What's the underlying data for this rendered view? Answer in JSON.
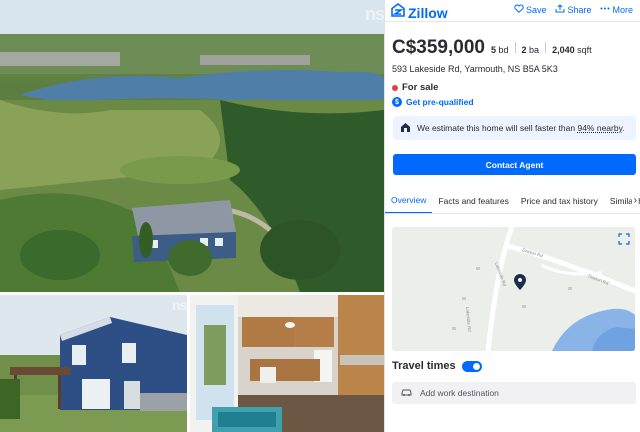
{
  "header": {
    "logo_text": "Zillow",
    "actions": [
      {
        "label": "Save",
        "icon": "heart-icon"
      },
      {
        "label": "Share",
        "icon": "share-icon"
      },
      {
        "label": "More",
        "icon": "more-icon"
      }
    ]
  },
  "gallery": {
    "watermark": "ns"
  },
  "listing": {
    "price": "C$359,000",
    "beds_value": "5",
    "beds_unit": "bd",
    "baths_value": "2",
    "baths_unit": "ba",
    "sqft_value": "2,040",
    "sqft_unit": "sqft",
    "address": "593 Lakeside Rd, Yarmouth, NS B5A 5K3",
    "status": "For sale",
    "status_color": "#e5403c",
    "prequal_label": "Get pre-qualified"
  },
  "estimate": {
    "text_before": "We estimate this home will sell faster than ",
    "percent": "94% nearby",
    "text_after": "."
  },
  "contact_button": "Contact Agent",
  "tabs": [
    {
      "label": "Overview"
    },
    {
      "label": "Facts and features"
    },
    {
      "label": "Price and tax history"
    },
    {
      "label": "Similar h"
    }
  ],
  "map": {
    "road_labels": [
      "Lakeside Rd",
      "Dayton Rd",
      "Dayton Rd",
      "Lakeside Rd"
    ]
  },
  "travel": {
    "title": "Travel times",
    "add_destination": "Add work destination"
  },
  "colors": {
    "accent": "#006aff",
    "text": "#2a2a33"
  }
}
